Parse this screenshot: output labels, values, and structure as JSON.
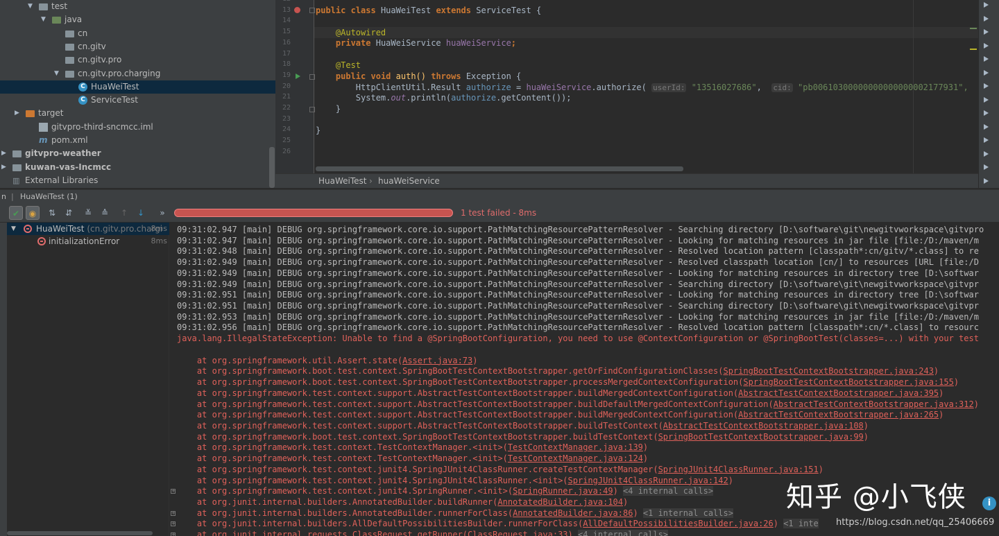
{
  "project_tree": [
    {
      "label": "test",
      "type": "folder",
      "indent": 2,
      "expanded": true
    },
    {
      "label": "java",
      "type": "folder-green",
      "indent": 3,
      "expanded": true
    },
    {
      "label": "cn",
      "type": "package",
      "indent": 4
    },
    {
      "label": "cn.gitv",
      "type": "package",
      "indent": 4
    },
    {
      "label": "cn.gitv.pro",
      "type": "package",
      "indent": 4
    },
    {
      "label": "cn.gitv.pro.charging",
      "type": "package",
      "indent": 4,
      "expanded": true
    },
    {
      "label": "HuaWeiTest",
      "type": "class",
      "indent": 5,
      "selected": true
    },
    {
      "label": "ServiceTest",
      "type": "class",
      "indent": 5
    },
    {
      "label": "target",
      "type": "folder-orange",
      "indent": 1,
      "collapsed": true
    },
    {
      "label": "gitvpro-third-sncmcc.iml",
      "type": "file",
      "indent": 2
    },
    {
      "label": "pom.xml",
      "type": "maven",
      "indent": 2
    },
    {
      "label": "gitvpro-weather",
      "type": "module",
      "indent": 0,
      "collapsed": true
    },
    {
      "label": "kuwan-vas-Incmcc",
      "type": "module",
      "indent": 0,
      "collapsed": true
    },
    {
      "label": "External Libraries",
      "type": "libraries",
      "indent": 0
    }
  ],
  "editor": {
    "line_numbers": [
      "12",
      "13",
      "14",
      "15",
      "16",
      "17",
      "18",
      "19",
      "20",
      "21",
      "22",
      "23",
      "24",
      "25",
      "26"
    ],
    "code": {
      "l13_public": "public",
      "l13_class": "class",
      "l13_name": "HuaWeiTest",
      "l13_extends": "extends",
      "l13_super": "ServiceTest {",
      "l15_ann": "@Autowired",
      "l16_private": "private",
      "l16_type": "HuaWeiService",
      "l16_field": "huaWeiService",
      "l16_semi": ";",
      "l18_ann": "@Test",
      "l19_public": "public",
      "l19_void": "void",
      "l19_method": "auth() ",
      "l19_throws": "throws",
      "l19_exc": "Exception {",
      "l20_type": "HttpClientUtil.Result ",
      "l20_var": "authorize",
      "l20_eq": " = ",
      "l20_field": "huaWeiService",
      "l20_call": ".authorize(",
      "l20_hint1": "userId:",
      "l20_str1": "\"13516027686\"",
      "l20_comma": ", ",
      "l20_hint2": "cid:",
      "l20_str2": "\"pb00610300000000000000002177931\",",
      "l21_sys": "System.",
      "l21_out": "out",
      "l21_println": ".println(",
      "l21_var": "authorize",
      "l21_rest": ".getContent());",
      "l22_brace": "}",
      "l24_brace": "}"
    }
  },
  "breadcrumb": [
    "HuaWeiTest",
    "huaWeiService"
  ],
  "run_window": {
    "title": "HuaWeiTest (1)",
    "tab_prefix": "n",
    "status": "1 test failed - 8ms",
    "toolbar": [
      "show-passed",
      "show-ignored",
      "sort-alpha",
      "sort-duration",
      "expand-all",
      "collapse-all",
      "prev-failed",
      "next-failed",
      "more"
    ],
    "tests": [
      {
        "label": "HuaWeiTest",
        "pkg": "(cn.gitv.pro.chargi",
        "duration": "8ms"
      },
      {
        "label": "initializationError",
        "duration": "8ms"
      }
    ]
  },
  "console": {
    "debug_lines": [
      "09:31:02.947 [main] DEBUG org.springframework.core.io.support.PathMatchingResourcePatternResolver - Searching directory [D:\\software\\git\\newgitvworkspace\\gitvpro",
      "09:31:02.947 [main] DEBUG org.springframework.core.io.support.PathMatchingResourcePatternResolver - Looking for matching resources in jar file [file:/D:/maven/m",
      "09:31:02.948 [main] DEBUG org.springframework.core.io.support.PathMatchingResourcePatternResolver - Resolved location pattern [classpath*:cn/gitv/*.class] to re",
      "09:31:02.949 [main] DEBUG org.springframework.core.io.support.PathMatchingResourcePatternResolver - Resolved classpath location [cn/] to resources [URL [file:/D",
      "09:31:02.949 [main] DEBUG org.springframework.core.io.support.PathMatchingResourcePatternResolver - Looking for matching resources in directory tree [D:\\softwar",
      "09:31:02.949 [main] DEBUG org.springframework.core.io.support.PathMatchingResourcePatternResolver - Searching directory [D:\\software\\git\\newgitvworkspace\\gitvpr",
      "09:31:02.951 [main] DEBUG org.springframework.core.io.support.PathMatchingResourcePatternResolver - Looking for matching resources in directory tree [D:\\softwar",
      "09:31:02.951 [main] DEBUG org.springframework.core.io.support.PathMatchingResourcePatternResolver - Searching directory [D:\\software\\git\\newgitvworkspace\\gitvpr",
      "09:31:02.953 [main] DEBUG org.springframework.core.io.support.PathMatchingResourcePatternResolver - Looking for matching resources in jar file [file:/D:/maven/m",
      "09:31:02.956 [main] DEBUG org.springframework.core.io.support.PathMatchingResourcePatternResolver - Resolved location pattern [classpath*:cn/*.class] to resourc"
    ],
    "exception": "java.lang.IllegalStateException: Unable to find a @SpringBootConfiguration, you need to use @ContextConfiguration or @SpringBootTest(classes=...) with your test",
    "stack": [
      {
        "at": "    at org.springframework.util.Assert.state(",
        "link": "Assert.java:73",
        "end": ")"
      },
      {
        "at": "    at org.springframework.boot.test.context.SpringBootTestContextBootstrapper.getOrFindConfigurationClasses(",
        "link": "SpringBootTestContextBootstrapper.java:243",
        "end": ")"
      },
      {
        "at": "    at org.springframework.boot.test.context.SpringBootTestContextBootstrapper.processMergedContextConfiguration(",
        "link": "SpringBootTestContextBootstrapper.java:155",
        "end": ")"
      },
      {
        "at": "    at org.springframework.test.context.support.AbstractTestContextBootstrapper.buildMergedContextConfiguration(",
        "link": "AbstractTestContextBootstrapper.java:395",
        "end": ")"
      },
      {
        "at": "    at org.springframework.test.context.support.AbstractTestContextBootstrapper.buildDefaultMergedContextConfiguration(",
        "link": "AbstractTestContextBootstrapper.java:312",
        "end": ")"
      },
      {
        "at": "    at org.springframework.test.context.support.AbstractTestContextBootstrapper.buildMergedContextConfiguration(",
        "link": "AbstractTestContextBootstrapper.java:265",
        "end": ")"
      },
      {
        "at": "    at org.springframework.test.context.support.AbstractTestContextBootstrapper.buildTestContext(",
        "link": "AbstractTestContextBootstrapper.java:108",
        "end": ")"
      },
      {
        "at": "    at org.springframework.boot.test.context.SpringBootTestContextBootstrapper.buildTestContext(",
        "link": "SpringBootTestContextBootstrapper.java:99",
        "end": ")"
      },
      {
        "at": "    at org.springframework.test.context.TestContextManager.<init>(",
        "link": "TestContextManager.java:139",
        "end": ")"
      },
      {
        "at": "    at org.springframework.test.context.TestContextManager.<init>(",
        "link": "TestContextManager.java:124",
        "end": ")"
      },
      {
        "at": "    at org.springframework.test.context.junit4.SpringJUnit4ClassRunner.createTestContextManager(",
        "link": "SpringJUnit4ClassRunner.java:151",
        "end": ")"
      },
      {
        "at": "    at org.springframework.test.context.junit4.SpringJUnit4ClassRunner.<init>(",
        "link": "SpringJUnit4ClassRunner.java:142",
        "end": ")"
      },
      {
        "at": "    at org.springframework.test.context.junit4.SpringRunner.<init>(",
        "link": "SpringRunner.java:49",
        "end": ") ",
        "internal": "<4 internal calls>",
        "plus": true
      },
      {
        "at": "    at org.junit.internal.builders.AnnotatedBuilder.buildRunner(",
        "link": "AnnotatedBuilder.java:104",
        "end": ")"
      },
      {
        "at": "    at org.junit.internal.builders.AnnotatedBuilder.runnerForClass(",
        "link": "AnnotatedBuilder.java:86",
        "end": ") ",
        "internal": "<1 internal calls>",
        "plus": true
      },
      {
        "at": "    at org.junit.internal.builders.AllDefaultPossibilitiesBuilder.runnerForClass(",
        "link": "AllDefaultPossibilitiesBuilder.java:26",
        "end": ") ",
        "internal": "<1 inte",
        "plus": true
      },
      {
        "at": "    at org.junit.internal.requests.ClassRequest.getRunner(",
        "link": "ClassRequest.java:33",
        "end": ") ",
        "internal": "<4 internal calls>",
        "plus": true
      }
    ]
  },
  "watermark": {
    "text": "知乎 @小飞侠",
    "url": "https://blog.csdn.net/qq_25406669"
  }
}
